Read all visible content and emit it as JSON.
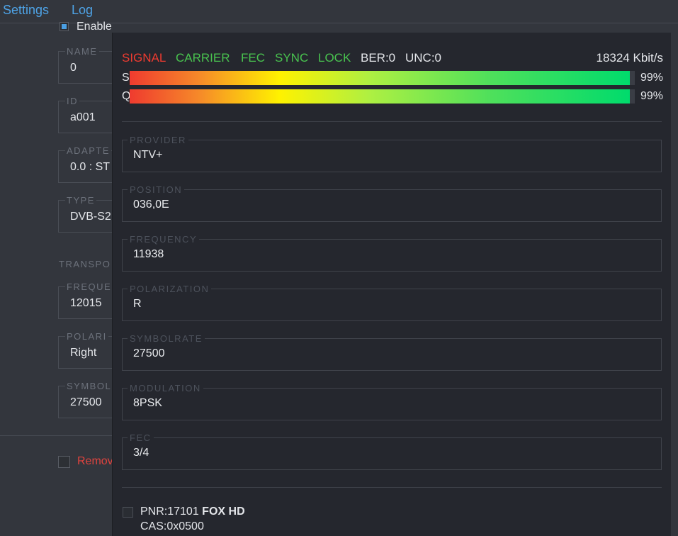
{
  "colors": {
    "accent": "#4ea3e6",
    "signal_error": "#ef3b30",
    "status_ok": "#49c34f",
    "danger": "#e0433e"
  },
  "topnav": {
    "settings": "Settings",
    "log": "Log"
  },
  "background_form": {
    "enable_label": "Enable",
    "enable_checked": true,
    "fields": [
      {
        "legend": "NAME",
        "value": "0"
      },
      {
        "legend": "ID",
        "value": "a001"
      },
      {
        "legend": "ADAPTE",
        "value": "0.0 : ST"
      },
      {
        "legend": "TYPE",
        "value": "DVB-S2"
      },
      {
        "legend": "FREQUE",
        "value": "12015"
      },
      {
        "legend": "POLARI",
        "value": "Right"
      },
      {
        "legend": "SYMBOL",
        "value": "27500"
      }
    ],
    "section_label": "TRANSPO",
    "remove_label": "Remov"
  },
  "status": {
    "signal": "SIGNAL",
    "carrier": "CARRIER",
    "fec": "FEC",
    "sync": "SYNC",
    "lock": "LOCK",
    "ber": "BER:0",
    "unc": "UNC:0",
    "bitrate": "18324 Kbit/s",
    "colors": {
      "signal": "#ef3b30",
      "carrier": "#49c34f",
      "fec": "#49c34f",
      "sync": "#49c34f",
      "lock": "#49c34f",
      "ber": "#e4e6ea",
      "unc": "#e4e6ea",
      "bitrate": "#e4e6ea"
    }
  },
  "meters": [
    {
      "label": "S",
      "percent": 99,
      "percent_text": "99%"
    },
    {
      "label": "Q",
      "percent": 99,
      "percent_text": "99%"
    }
  ],
  "transponder": [
    {
      "legend": "PROVIDER",
      "value": "NTV+"
    },
    {
      "legend": "POSITION",
      "value": "036,0E"
    },
    {
      "legend": "FREQUENCY",
      "value": "11938"
    },
    {
      "legend": "POLARIZATION",
      "value": "R"
    },
    {
      "legend": "SYMBOLRATE",
      "value": "27500"
    },
    {
      "legend": "MODULATION",
      "value": "8PSK"
    },
    {
      "legend": "FEC",
      "value": "3/4"
    }
  ],
  "service": {
    "pnr": "PNR:17101",
    "name": "FOX HD",
    "cas": "CAS:0x0500",
    "checked": false
  }
}
